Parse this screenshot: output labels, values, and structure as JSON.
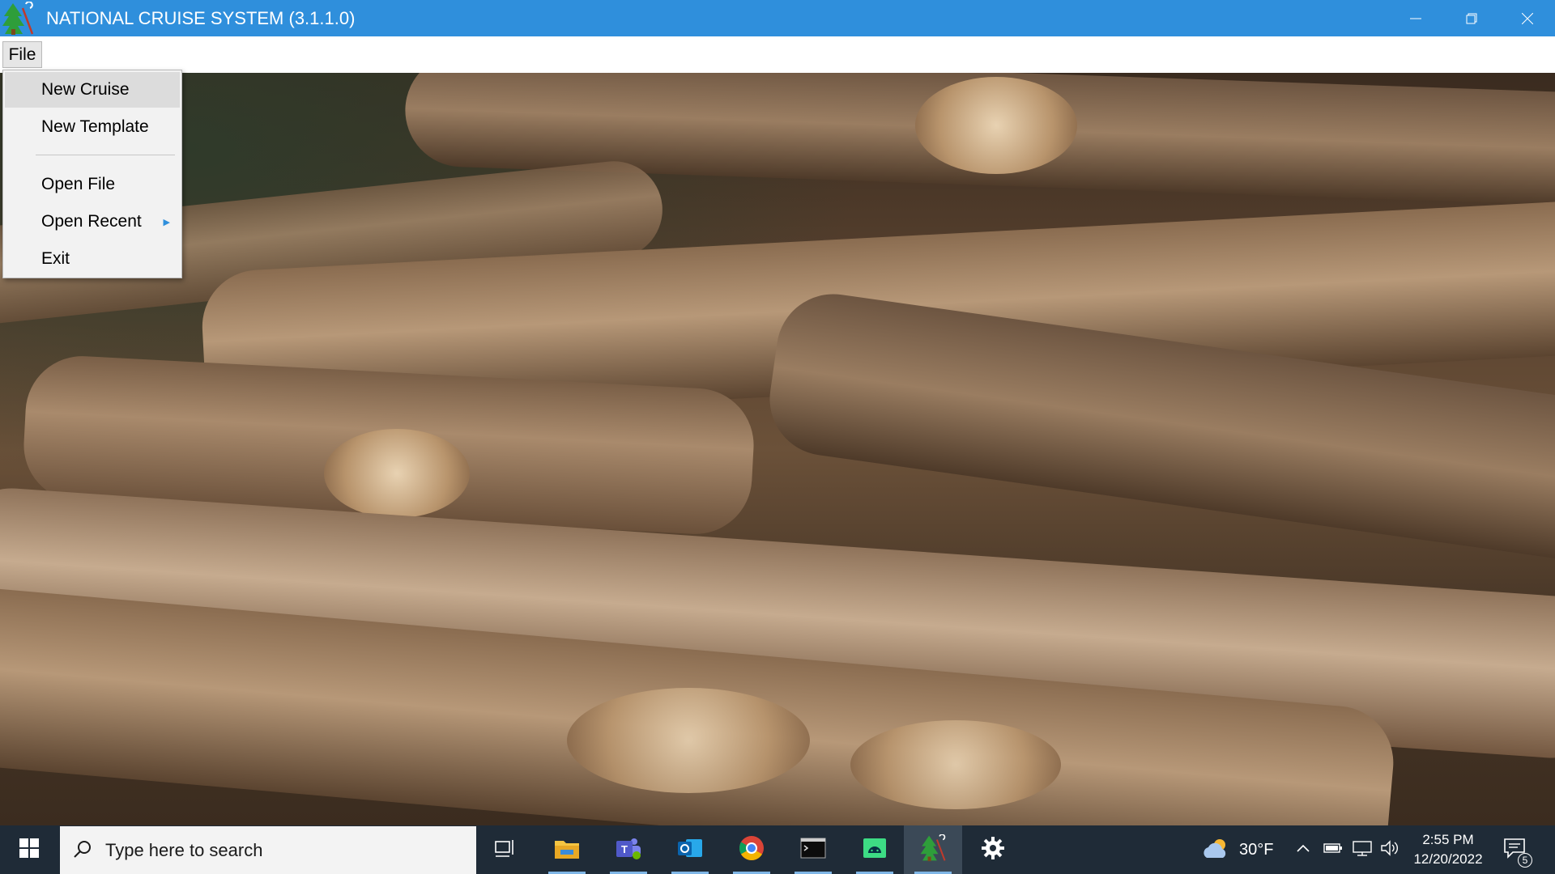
{
  "window": {
    "title": "NATIONAL CRUISE SYSTEM (3.1.1.0)",
    "app_icon": "tree-icon",
    "controls": {
      "minimize": "minimize-icon",
      "restore": "restore-icon",
      "close": "close-icon"
    }
  },
  "menubar": {
    "file_label": "File"
  },
  "file_menu": {
    "items": [
      {
        "label": "New Cruise",
        "highlighted": true
      },
      {
        "label": "New Template"
      },
      {
        "label": "Open File"
      },
      {
        "label": "Open Recent",
        "submenu": true
      },
      {
        "label": "Exit"
      }
    ]
  },
  "taskbar": {
    "search_placeholder": "Type here to search",
    "apps": [
      "task-view-icon",
      "file-explorer-icon",
      "teams-icon",
      "outlook-icon",
      "chrome-icon",
      "terminal-icon",
      "android-studio-icon",
      "national-cruise-icon",
      "settings-icon"
    ],
    "weather": {
      "temp": "30°F",
      "icon": "cloudy-weather-icon"
    },
    "clock": {
      "time": "2:55 PM",
      "date": "12/20/2022"
    },
    "notifications_count": "5"
  },
  "colors": {
    "titlebar": "#2f8fdc",
    "taskbar": "#1f2b37",
    "menu_bg": "#f2f2f2"
  }
}
